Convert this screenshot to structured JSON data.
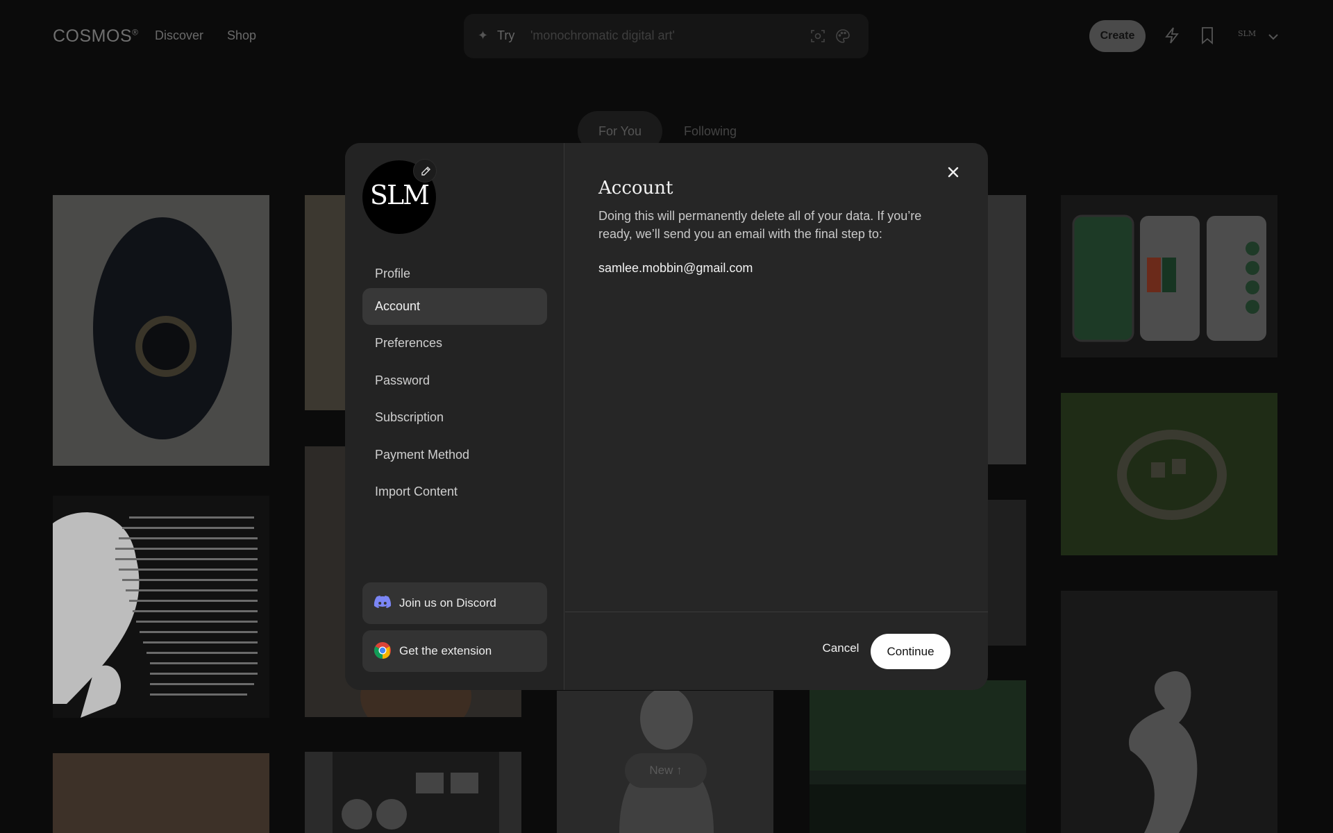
{
  "header": {
    "logo": "COSMOS",
    "logo_mark": "®",
    "nav": [
      "Discover",
      "Shop"
    ],
    "search": {
      "prefix": "Try",
      "suggestion": "'monochromatic digital art'"
    },
    "create_label": "Create",
    "user_initials": "SLM",
    "icons": [
      "sparkle-icon",
      "camera-scan-icon",
      "palette-icon",
      "lightning-icon",
      "bookmark-icon",
      "chevron-down-icon"
    ]
  },
  "feed_tabs": {
    "active": "For You",
    "other": "Following"
  },
  "feed": {
    "new_badge": "New ↑"
  },
  "modal": {
    "avatar_text": "SLM",
    "sidebar": {
      "items": [
        {
          "label": "Profile",
          "active": false
        },
        {
          "label": "Account",
          "active": true
        },
        {
          "label": "Preferences",
          "active": false
        },
        {
          "label": "Password",
          "active": false
        },
        {
          "label": "Subscription",
          "active": false
        },
        {
          "label": "Payment Method",
          "active": false
        },
        {
          "label": "Import Content",
          "active": false
        }
      ],
      "discord_label": "Join us on Discord",
      "extension_label": "Get the extension"
    },
    "main": {
      "title": "Account",
      "description": "Doing this will permanently delete all of your data. If you’re ready, we’ll send you an email with the final step to:",
      "email": "samlee.mobbin@gmail.com",
      "cancel_label": "Cancel",
      "continue_label": "Continue"
    }
  },
  "colors": {
    "page_bg": "#0b0b0b",
    "modal_bg": "#262626",
    "sidebar_active_bg": "#383838",
    "primary_button": "#ffffff",
    "discord": "#5865f2"
  }
}
